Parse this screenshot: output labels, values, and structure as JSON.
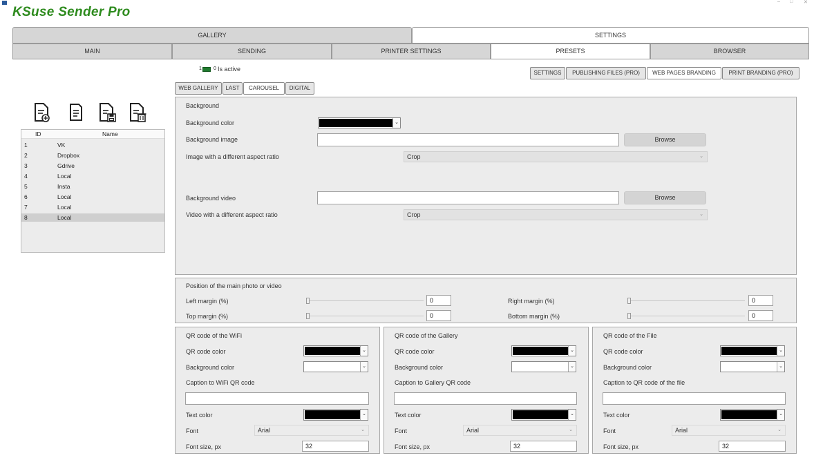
{
  "app": {
    "title": "KSuse Sender Pro",
    "window_controls": [
      "–",
      "□",
      "✕"
    ]
  },
  "top_tabs": [
    {
      "label": "GALLERY",
      "selected": false
    },
    {
      "label": "SETTINGS",
      "selected": true
    }
  ],
  "second_tabs": [
    {
      "label": "MAIN",
      "selected": false
    },
    {
      "label": "SENDING",
      "selected": false
    },
    {
      "label": "PRINTER SETTINGS",
      "selected": false
    },
    {
      "label": "PRESETS",
      "selected": true
    },
    {
      "label": "BROWSER",
      "selected": false
    }
  ],
  "active_toggle": {
    "left": "1",
    "right": "0",
    "label": "Is active"
  },
  "preset_tabs": [
    {
      "label": "SETTINGS",
      "selected": false
    },
    {
      "label": "PUBLISHING FILES (PRO)",
      "selected": false
    },
    {
      "label": "WEB PAGES BRANDING",
      "selected": true
    },
    {
      "label": "PRINT BRANDING (PRO)",
      "selected": false
    }
  ],
  "page_tabs": [
    {
      "label": "WEB GALLERY",
      "selected": false
    },
    {
      "label": "LAST",
      "selected": false
    },
    {
      "label": "CAROUSEL",
      "selected": true
    },
    {
      "label": "DIGITAL",
      "selected": false
    }
  ],
  "presets_table": {
    "headers": [
      "ID",
      "Name"
    ],
    "rows": [
      {
        "id": "1",
        "name": "VK"
      },
      {
        "id": "2",
        "name": "Dropbox"
      },
      {
        "id": "3",
        "name": "Gdrive"
      },
      {
        "id": "4",
        "name": "Local"
      },
      {
        "id": "5",
        "name": "Insta"
      },
      {
        "id": "6",
        "name": "Local"
      },
      {
        "id": "7",
        "name": "Local"
      },
      {
        "id": "8",
        "name": "Local"
      }
    ],
    "selected_row": 8
  },
  "toolbar_icons": [
    "new-file-icon",
    "copy-file-icon",
    "save-file-icon",
    "delete-file-icon"
  ],
  "background": {
    "section_title": "Background",
    "color_label": "Background color",
    "color_value": "#000000",
    "image_label": "Background image",
    "image_value": "",
    "browse_label": "Browse",
    "image_aspect_label": "Image with a different aspect ratio",
    "image_aspect_value": "Crop",
    "video_label": "Background video",
    "video_value": "",
    "video_browse_label": "Browse",
    "video_aspect_label": "Video with a different aspect ratio",
    "video_aspect_value": "Crop"
  },
  "position": {
    "section_title": "Position of the main photo or video",
    "left_label": "Left margin (%)",
    "left_value": "0",
    "right_label": "Right margin (%)",
    "right_value": "0",
    "top_label": "Top margin (%)",
    "top_value": "0",
    "bottom_label": "Bottom margin (%)",
    "bottom_value": "0"
  },
  "qr_panels": [
    {
      "title": "QR code of the WiFi",
      "qr_color_label": "QR code color",
      "qr_color": "#000000",
      "bg_color_label": "Background color",
      "bg_color": "#ffffff",
      "caption_label": "Caption to WiFi QR code",
      "caption_value": "",
      "text_color_label": "Text color",
      "text_color": "#000000",
      "font_label": "Font",
      "font_value": "Arial",
      "font_size_label": "Font size, px",
      "font_size_value": "32"
    },
    {
      "title": "QR code of the Gallery",
      "qr_color_label": "QR code color",
      "qr_color": "#000000",
      "bg_color_label": "Background color",
      "bg_color": "#ffffff",
      "caption_label": "Caption to Gallery QR code",
      "caption_value": "",
      "text_color_label": "Text color",
      "text_color": "#000000",
      "font_label": "Font",
      "font_value": "Arial",
      "font_size_label": "Font size, px",
      "font_size_value": "32"
    },
    {
      "title": "QR code of the File",
      "qr_color_label": "QR code color",
      "qr_color": "#000000",
      "bg_color_label": "Background color",
      "bg_color": "#ffffff",
      "caption_label": "Caption to QR code of the file",
      "caption_value": "",
      "text_color_label": "Text color",
      "text_color": "#000000",
      "font_label": "Font",
      "font_value": "Arial",
      "font_size_label": "Font size, px",
      "font_size_value": "32"
    }
  ],
  "colors": {
    "brand_green": "#2e8b1e",
    "toggle_green": "#1f7a2e"
  }
}
